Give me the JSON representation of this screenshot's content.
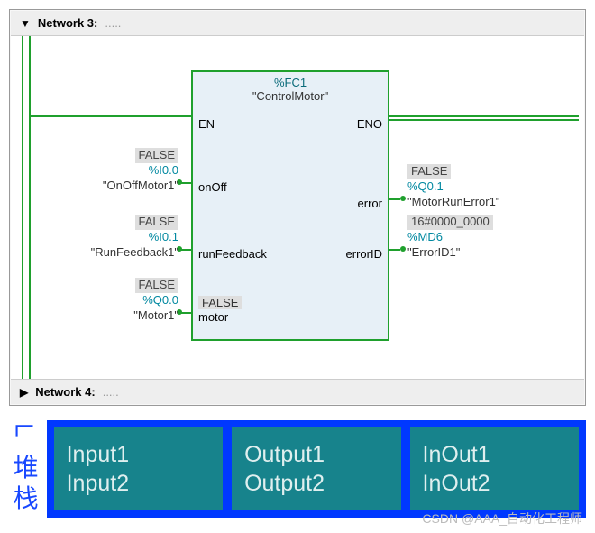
{
  "network3": {
    "title": "Network 3:",
    "chevron": "▼",
    "dots": "....."
  },
  "block": {
    "type": "%FC1",
    "name": "\"ControlMotor\"",
    "en": "EN",
    "eno": "ENO",
    "ports": {
      "onOff": "onOff",
      "runFeedback": "runFeedback",
      "motor": "motor",
      "motor_val": "FALSE",
      "error": "error",
      "errorID": "errorID"
    }
  },
  "inputs": {
    "onOff": {
      "val": "FALSE",
      "addr": "%I0.0",
      "tag": "\"OnOffMotor1\""
    },
    "runFb": {
      "val": "FALSE",
      "addr": "%I0.1",
      "tag": "\"RunFeedback1\""
    },
    "motor": {
      "val": "FALSE",
      "addr": "%Q0.0",
      "tag": "\"Motor1\""
    }
  },
  "outputs": {
    "error": {
      "val": "FALSE",
      "addr": "%Q0.1",
      "tag": "\"MotorRunError1\""
    },
    "errorID": {
      "val": "16#0000_0000",
      "addr": "%MD6",
      "tag": "\"ErrorID1\""
    }
  },
  "network4": {
    "title": "Network 4:",
    "chevron": "▶",
    "dots": "....."
  },
  "stack": {
    "label": "L 堆栈",
    "boxes": [
      {
        "l1": "Input1",
        "l2": "Input2"
      },
      {
        "l1": "Output1",
        "l2": "Output2"
      },
      {
        "l1": "InOut1",
        "l2": "InOut2"
      }
    ]
  },
  "watermark": "CSDN @AAA_自动化工程师"
}
